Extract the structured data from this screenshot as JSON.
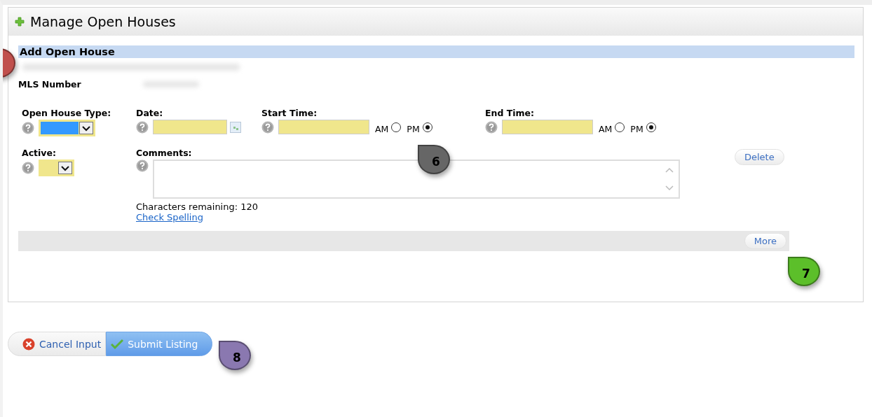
{
  "panel": {
    "title": "Manage Open Houses"
  },
  "section": {
    "title": "Add Open House"
  },
  "mls_label": "MLS Number",
  "type_field": {
    "label": "Open House Type:",
    "focused": true
  },
  "date_field": {
    "label": "Date:"
  },
  "times": [
    {
      "label": "Start Time:",
      "options": [
        {
          "label": "AM",
          "selected": false
        },
        {
          "label": "PM",
          "selected": true
        }
      ]
    },
    {
      "label": "End Time:",
      "options": [
        {
          "label": "AM",
          "selected": false
        },
        {
          "label": "PM",
          "selected": true
        }
      ]
    }
  ],
  "active_field": {
    "label": "Active:",
    "focused": false
  },
  "comments": {
    "label": "Comments:",
    "remaining": "Characters remaining: 120",
    "spell_link": "Check Spelling"
  },
  "delete_button": "Delete",
  "more_button": "More",
  "actions": [
    {
      "label": "Cancel Input",
      "kind": "cancel"
    },
    {
      "label": "Submit Listing",
      "kind": "submit"
    }
  ],
  "callouts": [
    {
      "color": "#c0504d"
    },
    {
      "number": "6",
      "color": "#666666"
    },
    {
      "number": "7",
      "color": "#5cbf2a"
    },
    {
      "number": "8",
      "color": "#8a78b0"
    }
  ]
}
